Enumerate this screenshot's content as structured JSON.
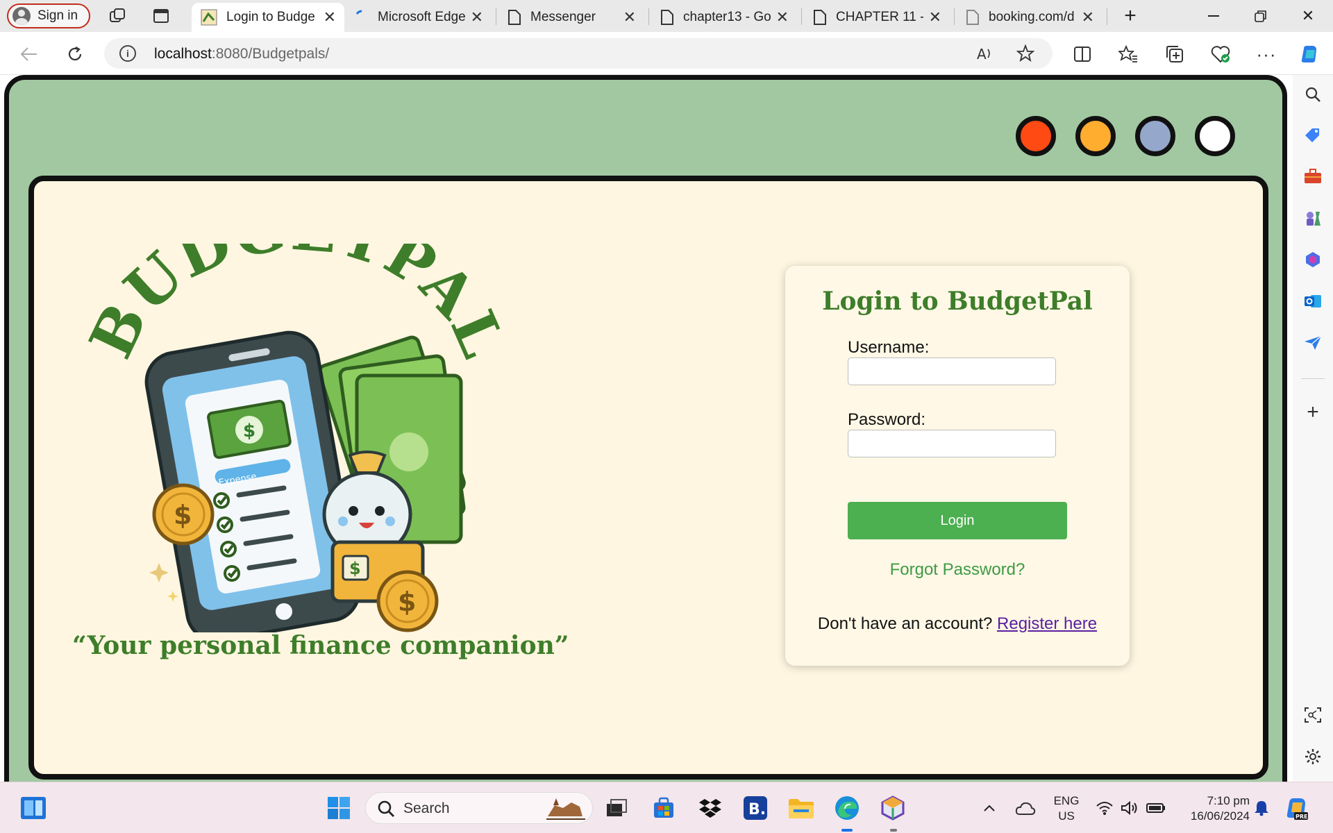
{
  "browser": {
    "profile_label": "Sign in",
    "tabs": [
      {
        "title": "Login to Budge"
      },
      {
        "title": "Microsoft Edge"
      },
      {
        "title": "Messenger"
      },
      {
        "title": "chapter13 - Go"
      },
      {
        "title": "CHAPTER 11 - "
      },
      {
        "title": "booking.com/d"
      }
    ],
    "url_host": "localhost",
    "url_path": ":8080/Budgetpals/"
  },
  "page": {
    "logo_wordmark": "BUDGETPAL",
    "logo_tag": "Expense",
    "tagline": "“Your personal finance companion”",
    "theme_dots": [
      "#ff4a14",
      "#ffad2e",
      "#95a8cc",
      "#ffffff"
    ],
    "login": {
      "title": "Login to BudgetPal",
      "username_label": "Username:",
      "username_value": "",
      "password_label": "Password:",
      "password_value": "",
      "submit_label": "Login",
      "forgot_label": "Forgot Password?",
      "register_prompt": "Don't have an account?",
      "register_link": "Register here"
    }
  },
  "taskbar": {
    "search_label": "Search",
    "lang_primary": "ENG",
    "lang_secondary": "US",
    "time": "7:10 pm",
    "date": "16/06/2024"
  },
  "colors": {
    "accent_green": "#3e7d2a",
    "button_green": "#4caf50",
    "frame_green": "#a2c8a2",
    "panel_cream": "#fef6e0"
  }
}
